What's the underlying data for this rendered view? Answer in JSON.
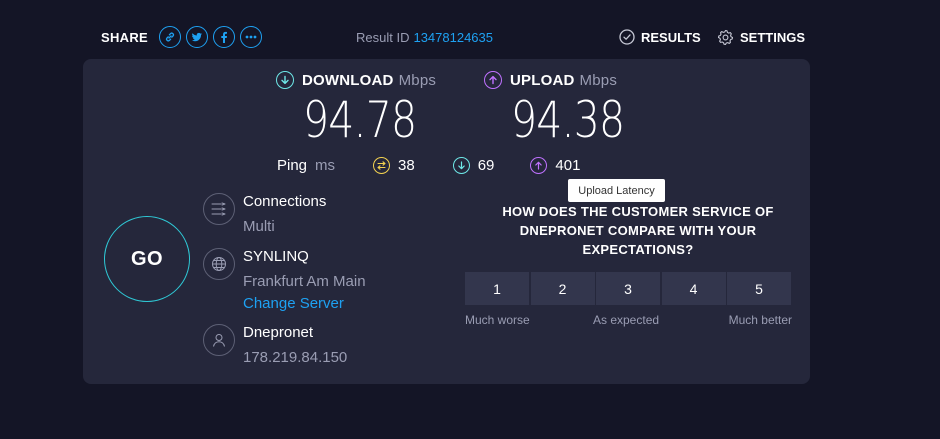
{
  "header": {
    "share_label": "SHARE",
    "share_buttons": [
      {
        "icon": "link-icon"
      },
      {
        "icon": "twitter-icon"
      },
      {
        "icon": "facebook-icon"
      },
      {
        "icon": "more-icon"
      }
    ],
    "result_label": "Result ID",
    "result_id": "13478124635",
    "results_label": "RESULTS",
    "settings_label": "SETTINGS"
  },
  "speeds": {
    "download": {
      "label": "DOWNLOAD",
      "unit": "Mbps",
      "value": "94.78"
    },
    "upload": {
      "label": "UPLOAD",
      "unit": "Mbps",
      "value": "94.38"
    }
  },
  "ping": {
    "label": "Ping",
    "unit": "ms",
    "idle": "38",
    "download": "69",
    "upload": "401"
  },
  "tooltip": "Upload Latency",
  "go_label": "GO",
  "connections": {
    "title": "Connections",
    "value": "Multi"
  },
  "server": {
    "title": "SYNLINQ",
    "location": "Frankfurt Am Main",
    "change_label": "Change Server"
  },
  "isp": {
    "title": "Dnepronet",
    "ip": "178.219.84.150"
  },
  "survey": {
    "question": "HOW DOES THE CUSTOMER SERVICE OF DNEPRONET COMPARE WITH YOUR EXPECTATIONS?",
    "options": [
      "1",
      "2",
      "3",
      "4",
      "5"
    ],
    "label_low": "Much worse",
    "label_mid": "As expected",
    "label_high": "Much better"
  },
  "colors": {
    "background": "#141526",
    "panel": "#25273b",
    "accent_blue": "#1ea1f2",
    "download": "#6ee7e7",
    "upload": "#bf71ff",
    "ping_idle": "#f3d250",
    "go_ring": "#2fc9d6"
  }
}
